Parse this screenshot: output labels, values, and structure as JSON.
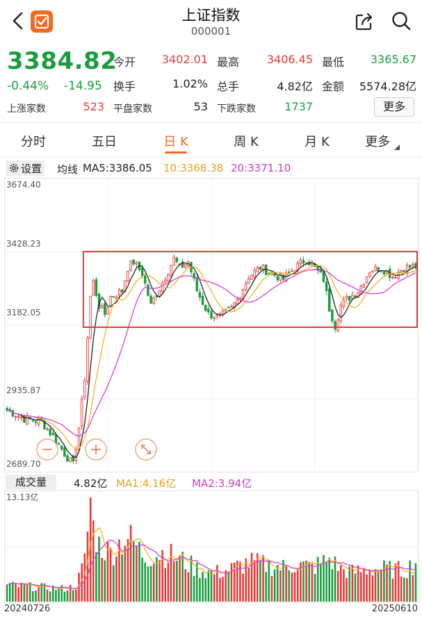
{
  "header": {
    "title": "上证指数",
    "code": "000001"
  },
  "quote": {
    "price": "3384.82",
    "change_pct": "-0.44%",
    "change": "-14.95",
    "labels": {
      "open": "今开",
      "high": "最高",
      "low": "最低",
      "turnover": "换手",
      "volume": "总手",
      "amount": "金额",
      "up_count": "上涨家数",
      "flat_count": "平盘家数",
      "down_count": "下跌家数"
    },
    "values": {
      "open": "3402.01",
      "high": "3406.45",
      "low": "3365.67",
      "turnover": "1.02%",
      "volume": "4.82亿",
      "amount": "5574.28亿",
      "up_count": "523",
      "flat_count": "53",
      "down_count": "1737"
    },
    "more_label": "更多"
  },
  "tabs": [
    "分时",
    "五日",
    "日 K",
    "周 K",
    "月 K",
    "更多"
  ],
  "active_tab": 2,
  "ma_bar": {
    "settings_label": "设置",
    "ma_label": "均线",
    "ma5": "MA5:3386.05",
    "ma10": "10:3368.38",
    "ma20": "20:3371.10"
  },
  "volume_bar": {
    "label": "成交量",
    "value": "4.82亿",
    "ma1": "MA1:4.16亿",
    "ma2": "MA2:3.94亿"
  },
  "chart_data": {
    "type": "candlestick",
    "price_axis": {
      "min": 2689.7,
      "max": 3674.4,
      "ticks": [
        "3674.40",
        "3428.23",
        "3182.05",
        "2935.87",
        "2689.70"
      ]
    },
    "volume_axis": {
      "max": 13.13,
      "max_label": "13.13亿"
    },
    "date_start": "20240726",
    "date_end": "20250610",
    "colors": {
      "up": "#e53935",
      "down": "#1a9c3e",
      "ma5": "#222222",
      "ma10": "#f0b429",
      "ma20": "#d63fd6",
      "highlight_box": "#e53935"
    },
    "highlight_range": {
      "price_top": 3435,
      "price_bottom": 3175,
      "start_index": 28
    },
    "close_anchors": [
      [
        0,
        2890
      ],
      [
        6,
        2860
      ],
      [
        12,
        2850
      ],
      [
        16,
        2800
      ],
      [
        20,
        2740
      ],
      [
        23,
        2700
      ],
      [
        25,
        2830
      ],
      [
        27,
        3000
      ],
      [
        29,
        3280
      ],
      [
        30,
        3330
      ],
      [
        32,
        3250
      ],
      [
        34,
        3220
      ],
      [
        36,
        3280
      ],
      [
        40,
        3300
      ],
      [
        42,
        3380
      ],
      [
        44,
        3400
      ],
      [
        47,
        3360
      ],
      [
        50,
        3250
      ],
      [
        54,
        3330
      ],
      [
        58,
        3410
      ],
      [
        60,
        3380
      ],
      [
        63,
        3400
      ],
      [
        66,
        3300
      ],
      [
        70,
        3220
      ],
      [
        74,
        3210
      ],
      [
        78,
        3240
      ],
      [
        80,
        3270
      ],
      [
        84,
        3350
      ],
      [
        88,
        3380
      ],
      [
        92,
        3360
      ],
      [
        96,
        3340
      ],
      [
        100,
        3380
      ],
      [
        104,
        3410
      ],
      [
        106,
        3390
      ],
      [
        110,
        3340
      ],
      [
        112,
        3240
      ],
      [
        114,
        3180
      ],
      [
        116,
        3250
      ],
      [
        118,
        3270
      ],
      [
        122,
        3300
      ],
      [
        126,
        3370
      ],
      [
        130,
        3380
      ],
      [
        134,
        3350
      ],
      [
        138,
        3380
      ],
      [
        142,
        3385
      ]
    ],
    "volume_anchors": [
      [
        0,
        2.0
      ],
      [
        10,
        1.8
      ],
      [
        20,
        1.6
      ],
      [
        24,
        1.9
      ],
      [
        27,
        5.0
      ],
      [
        29,
        12.5
      ],
      [
        30,
        9.0
      ],
      [
        32,
        7.0
      ],
      [
        36,
        6.0
      ],
      [
        40,
        7.5
      ],
      [
        42,
        8.0
      ],
      [
        48,
        5.5
      ],
      [
        54,
        6.0
      ],
      [
        60,
        5.2
      ],
      [
        66,
        4.0
      ],
      [
        72,
        3.5
      ],
      [
        78,
        4.0
      ],
      [
        84,
        4.8
      ],
      [
        90,
        4.5
      ],
      [
        96,
        4.2
      ],
      [
        100,
        4.6
      ],
      [
        106,
        4.2
      ],
      [
        112,
        5.2
      ],
      [
        116,
        4.0
      ],
      [
        120,
        3.6
      ],
      [
        126,
        4.0
      ],
      [
        132,
        4.0
      ],
      [
        138,
        3.8
      ],
      [
        142,
        4.8
      ]
    ]
  }
}
